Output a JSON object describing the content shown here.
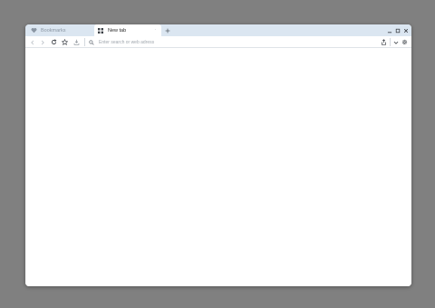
{
  "tabs": [
    {
      "label": "Bookmarks",
      "icon": "heart-icon",
      "active": false
    },
    {
      "label": "New tab",
      "icon": "grid-icon",
      "active": true
    }
  ],
  "tab_close_glyph": "·",
  "new_tab_icon": "plus-icon",
  "window_controls": [
    "minimize-icon",
    "maximize-icon",
    "close-icon"
  ],
  "toolbar": {
    "left_buttons": [
      "back-arrow-icon",
      "forward-arrow-icon",
      "reload-icon",
      "star-icon",
      "download-icon"
    ],
    "right_buttons": [
      "share-icon",
      "chevron-down-icon",
      "gear-icon"
    ]
  },
  "address_bar": {
    "value": "",
    "placeholder": "Enter search or web adress",
    "icon": "search-icon"
  },
  "colors": {
    "desktop": "#808080",
    "tabstrip": "#dbe6f1",
    "active_tab": "#ffffff",
    "inactive_tab_text": "#8a96a3",
    "icon": "#4a4f55",
    "icon_disabled": "#b6bcc3"
  }
}
